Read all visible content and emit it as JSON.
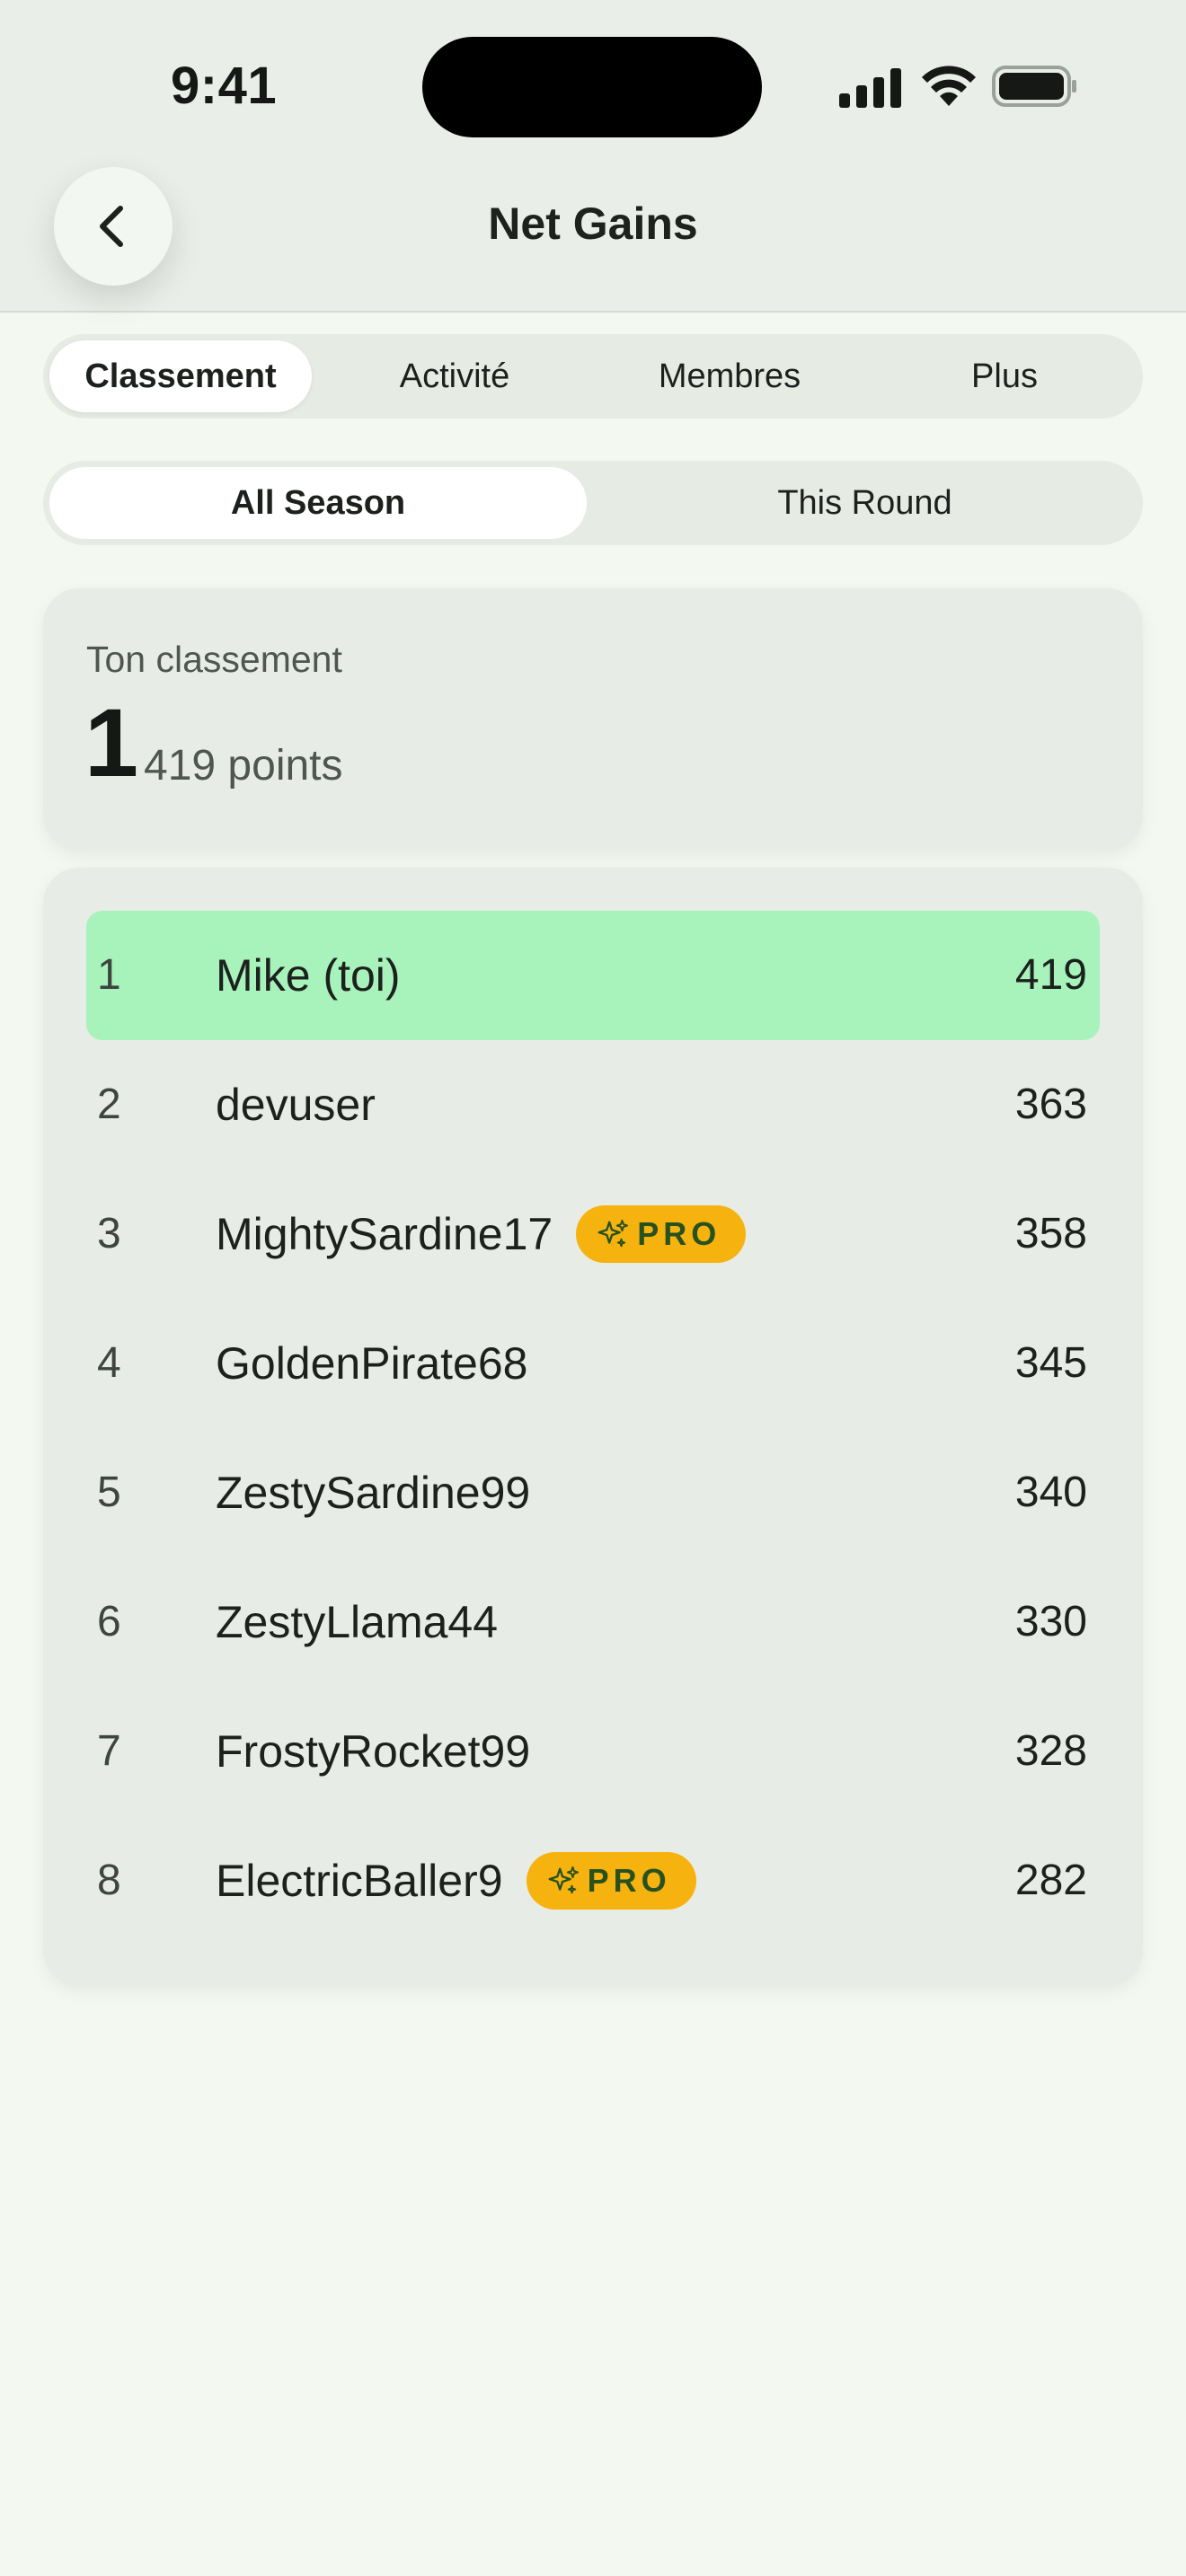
{
  "status_bar": {
    "time": "9:41",
    "icons": [
      "cellular-signal-icon",
      "wifi-icon",
      "battery-icon"
    ]
  },
  "header": {
    "back_icon": "chevron-left-icon",
    "title": "Net Gains"
  },
  "tabs": [
    {
      "label": "Classement",
      "active": true
    },
    {
      "label": "Activité",
      "active": false
    },
    {
      "label": "Membres",
      "active": false
    },
    {
      "label": "Plus",
      "active": false
    }
  ],
  "period_toggle": [
    {
      "label": "All Season",
      "active": true
    },
    {
      "label": "This Round",
      "active": false
    }
  ],
  "my_ranking": {
    "label": "Ton classement",
    "rank": "1",
    "points": "419 points"
  },
  "leaderboard": [
    {
      "rank": "1",
      "name": "Mike (toi)",
      "score": "419",
      "pro": false,
      "current_user": true
    },
    {
      "rank": "2",
      "name": "devuser",
      "score": "363",
      "pro": false,
      "current_user": false
    },
    {
      "rank": "3",
      "name": "MightySardine17",
      "score": "358",
      "pro": true,
      "current_user": false
    },
    {
      "rank": "4",
      "name": "GoldenPirate68",
      "score": "345",
      "pro": false,
      "current_user": false
    },
    {
      "rank": "5",
      "name": "ZestySardine99",
      "score": "340",
      "pro": false,
      "current_user": false
    },
    {
      "rank": "6",
      "name": "ZestyLlama44",
      "score": "330",
      "pro": false,
      "current_user": false
    },
    {
      "rank": "7",
      "name": "FrostyRocket99",
      "score": "328",
      "pro": false,
      "current_user": false
    },
    {
      "rank": "8",
      "name": "ElectricBaller9",
      "score": "282",
      "pro": true,
      "current_user": false
    }
  ],
  "badge": {
    "label": "PRO",
    "icon": "sparkle-icon"
  },
  "colors": {
    "highlight": "#a7f3bb",
    "pro_badge": "#f6b20f",
    "pro_text": "#27511f",
    "background": "#f3f8f1",
    "card": "#e8ece6"
  }
}
